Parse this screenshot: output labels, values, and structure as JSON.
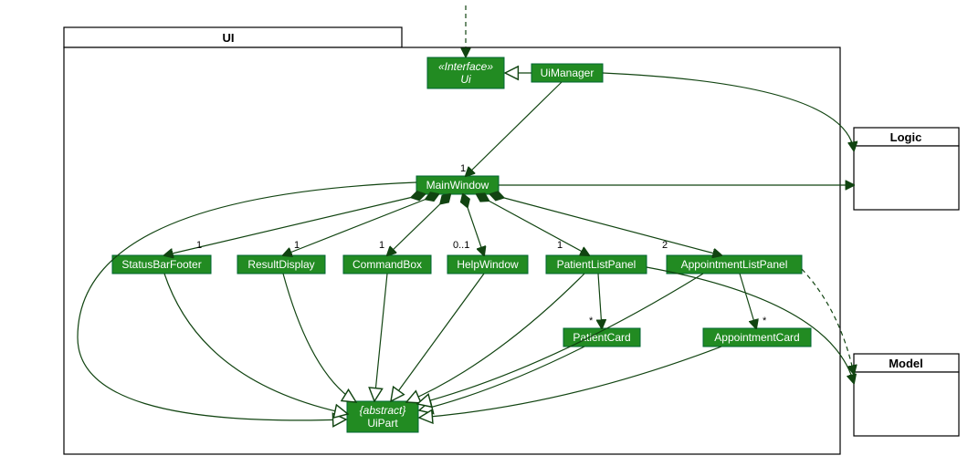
{
  "packages": {
    "ui": {
      "label": "UI"
    },
    "logic": {
      "label": "Logic"
    },
    "model": {
      "label": "Model"
    }
  },
  "classes": {
    "ui_if": {
      "stereo": "«Interface»",
      "name": "Ui"
    },
    "uimgr": {
      "name": "UiManager"
    },
    "main": {
      "name": "MainWindow"
    },
    "sbf": {
      "name": "StatusBarFooter"
    },
    "rd": {
      "name": "ResultDisplay"
    },
    "cb": {
      "name": "CommandBox"
    },
    "hw": {
      "name": "HelpWindow"
    },
    "plp": {
      "name": "PatientListPanel"
    },
    "alp": {
      "name": "AppointmentListPanel"
    },
    "pc": {
      "name": "PatientCard"
    },
    "ac": {
      "name": "AppointmentCard"
    },
    "uipart": {
      "stereo": "{abstract}",
      "name": "UiPart"
    }
  },
  "mult": {
    "main_uimgr": "1",
    "sbf": "1",
    "rd": "1",
    "cb": "1",
    "hw": "0..1",
    "plp": "1",
    "alp": "2",
    "pc": "*",
    "ac": "*"
  },
  "chart_data": {
    "type": "table",
    "title": "UI package class diagram",
    "nodes": [
      {
        "id": "Ui",
        "kind": "interface",
        "package": "UI"
      },
      {
        "id": "UiManager",
        "kind": "class",
        "package": "UI"
      },
      {
        "id": "MainWindow",
        "kind": "class",
        "package": "UI"
      },
      {
        "id": "StatusBarFooter",
        "kind": "class",
        "package": "UI"
      },
      {
        "id": "ResultDisplay",
        "kind": "class",
        "package": "UI"
      },
      {
        "id": "CommandBox",
        "kind": "class",
        "package": "UI"
      },
      {
        "id": "HelpWindow",
        "kind": "class",
        "package": "UI"
      },
      {
        "id": "PatientListPanel",
        "kind": "class",
        "package": "UI"
      },
      {
        "id": "AppointmentListPanel",
        "kind": "class",
        "package": "UI"
      },
      {
        "id": "PatientCard",
        "kind": "class",
        "package": "UI"
      },
      {
        "id": "AppointmentCard",
        "kind": "class",
        "package": "UI"
      },
      {
        "id": "UiPart",
        "kind": "abstract",
        "package": "UI"
      },
      {
        "id": "Logic",
        "kind": "package"
      },
      {
        "id": "Model",
        "kind": "package"
      }
    ],
    "edges": [
      {
        "from": "outside",
        "to": "Ui",
        "type": "dependency"
      },
      {
        "from": "UiManager",
        "to": "Ui",
        "type": "realization"
      },
      {
        "from": "UiManager",
        "to": "MainWindow",
        "type": "association",
        "mult_to": "1"
      },
      {
        "from": "MainWindow",
        "to": "StatusBarFooter",
        "type": "composition",
        "mult_to": "1"
      },
      {
        "from": "MainWindow",
        "to": "ResultDisplay",
        "type": "composition",
        "mult_to": "1"
      },
      {
        "from": "MainWindow",
        "to": "CommandBox",
        "type": "composition",
        "mult_to": "1"
      },
      {
        "from": "MainWindow",
        "to": "HelpWindow",
        "type": "composition",
        "mult_to": "0..1"
      },
      {
        "from": "MainWindow",
        "to": "PatientListPanel",
        "type": "composition",
        "mult_to": "1"
      },
      {
        "from": "MainWindow",
        "to": "AppointmentListPanel",
        "type": "composition",
        "mult_to": "2"
      },
      {
        "from": "PatientListPanel",
        "to": "PatientCard",
        "type": "association",
        "mult_to": "*"
      },
      {
        "from": "AppointmentListPanel",
        "to": "AppointmentCard",
        "type": "association",
        "mult_to": "*"
      },
      {
        "from": "MainWindow",
        "to": "UiPart",
        "type": "generalization"
      },
      {
        "from": "StatusBarFooter",
        "to": "UiPart",
        "type": "generalization"
      },
      {
        "from": "ResultDisplay",
        "to": "UiPart",
        "type": "generalization"
      },
      {
        "from": "CommandBox",
        "to": "UiPart",
        "type": "generalization"
      },
      {
        "from": "HelpWindow",
        "to": "UiPart",
        "type": "generalization"
      },
      {
        "from": "PatientListPanel",
        "to": "UiPart",
        "type": "generalization"
      },
      {
        "from": "PatientCard",
        "to": "UiPart",
        "type": "generalization"
      },
      {
        "from": "AppointmentListPanel",
        "to": "UiPart",
        "type": "generalization"
      },
      {
        "from": "AppointmentCard",
        "to": "UiPart",
        "type": "generalization"
      },
      {
        "from": "UiManager",
        "to": "Logic",
        "type": "association"
      },
      {
        "from": "MainWindow",
        "to": "Logic",
        "type": "association"
      },
      {
        "from": "PatientListPanel",
        "to": "Model",
        "type": "association"
      },
      {
        "from": "AppointmentListPanel",
        "to": "Model",
        "type": "dependency"
      }
    ]
  }
}
